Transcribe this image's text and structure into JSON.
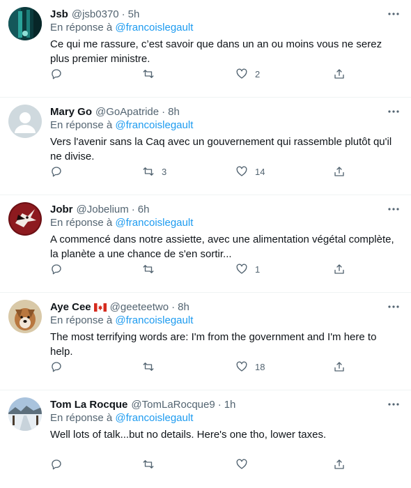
{
  "reply_prefix": "En réponse à",
  "tweets": [
    {
      "name": "Jsb",
      "handle": "@jsb0370",
      "time": "5h",
      "reply_to": "@francoislegault",
      "text": "Ce qui me rassure, c’est savoir que dans un an ou moins vous ne serez plus premier ministre.",
      "replies": "",
      "retweets": "",
      "likes": "2"
    },
    {
      "name": "Mary Go",
      "handle": "@GoApatride",
      "time": "8h",
      "reply_to": "@francoislegault",
      "text": "Vers l'avenir sans la Caq avec un gouvernement qui rassemble plutôt qu'il ne divise.",
      "replies": "",
      "retweets": "3",
      "likes": "14"
    },
    {
      "name": "Jobr",
      "handle": "@Jobelium",
      "time": "6h",
      "reply_to": "@francoislegault",
      "text": "A commencé dans notre assiette, avec une alimentation végétal complète, la planète a une chance de s'en sortir...",
      "replies": "",
      "retweets": "",
      "likes": "1"
    },
    {
      "name": "Aye Cee",
      "handle": "@geeteetwo",
      "time": "8h",
      "reply_to": "@francoislegault",
      "text": "The most terrifying words are: I'm from the government and I'm here to help.",
      "replies": "",
      "retweets": "",
      "likes": "18"
    },
    {
      "name": "Tom La Rocque",
      "handle": "@TomLaRocque9",
      "time": "1h",
      "reply_to": "@francoislegault",
      "text": "Well lots of talk...but no details.  Here's one tho, lower taxes.",
      "replies": "",
      "retweets": "",
      "likes": ""
    }
  ]
}
